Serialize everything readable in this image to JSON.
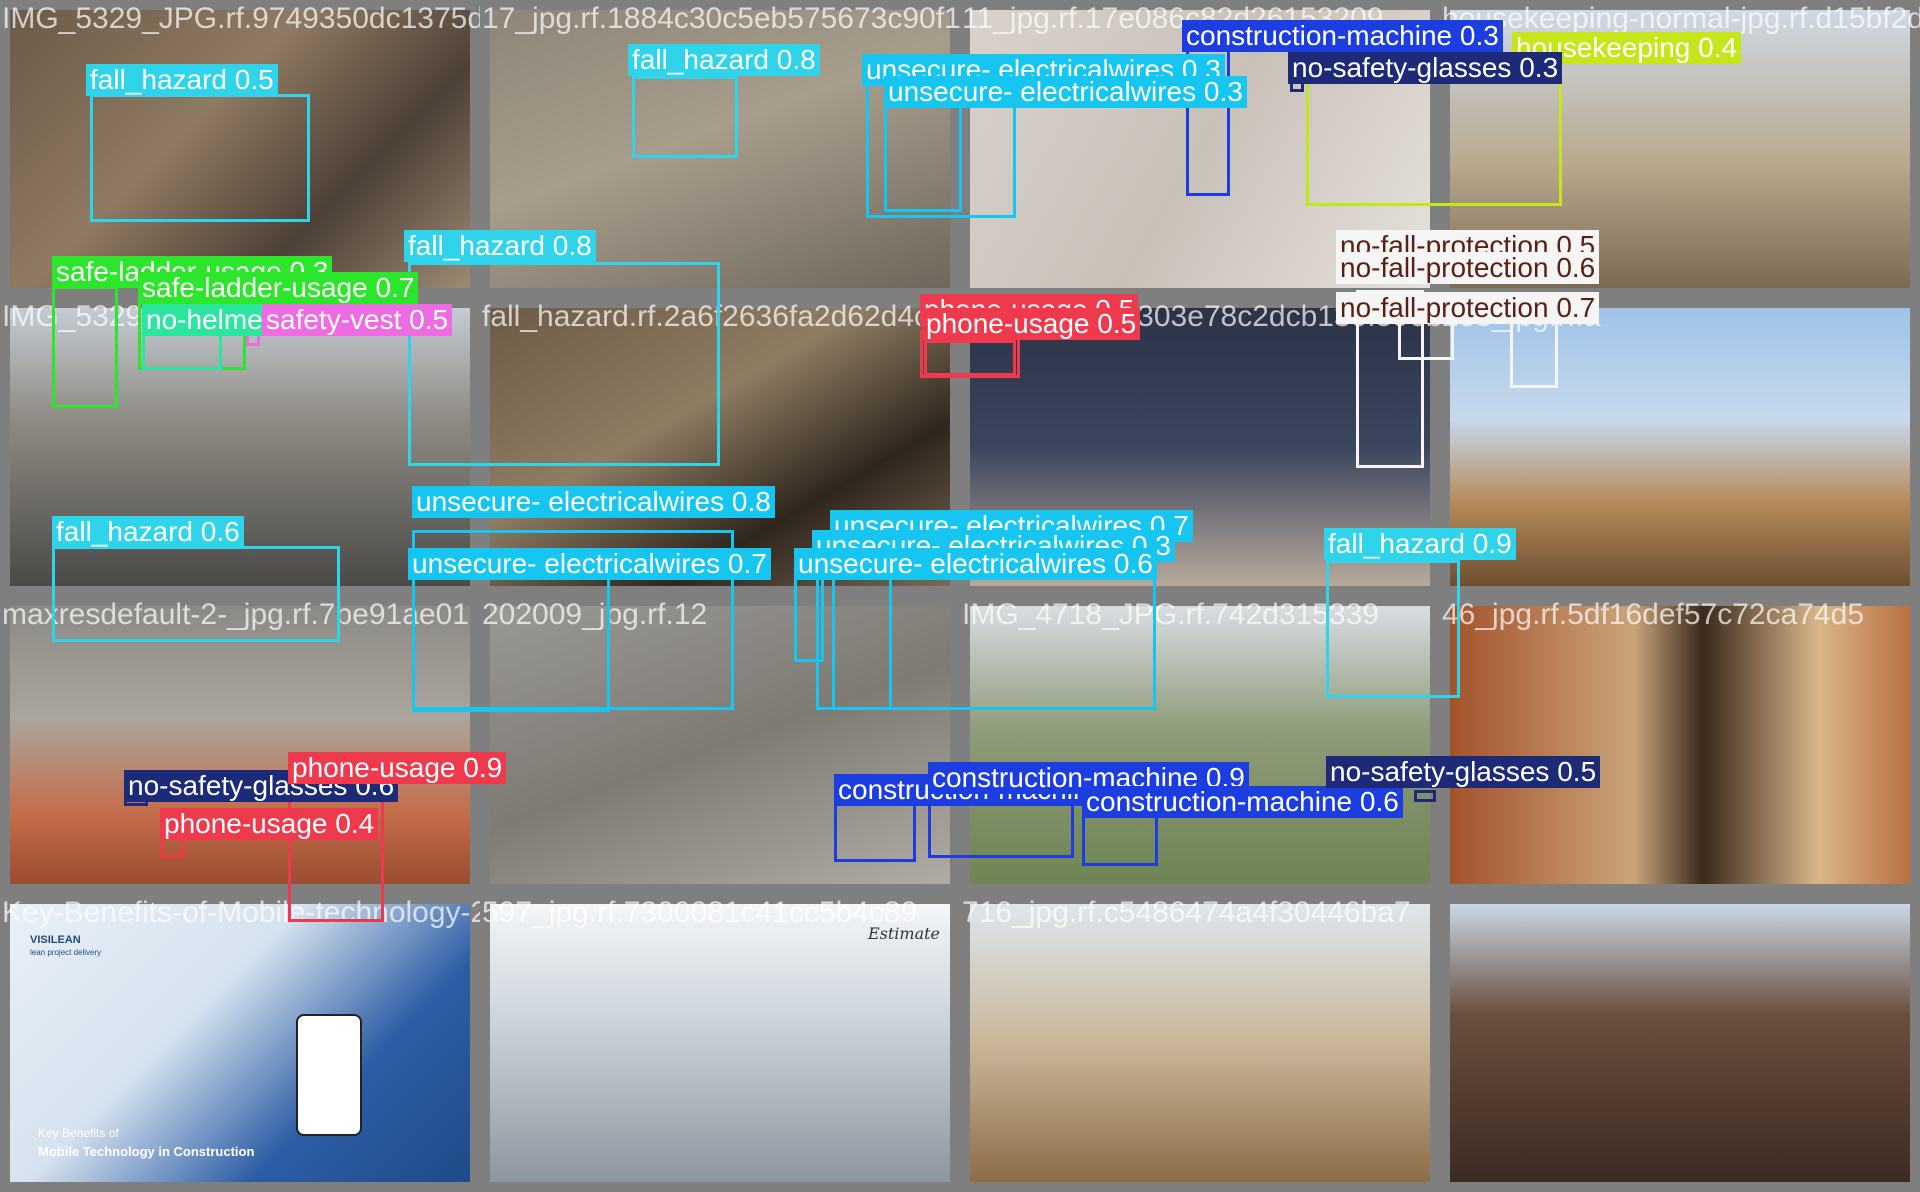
{
  "colors": {
    "fall_hazard": "#2FD3EA",
    "unsecure_electricalwires": "#16C5F0",
    "construction_machine": "#1C3EE0",
    "no_safety_glasses": "#1D2A78",
    "housekeeping": "#C6E51B",
    "safe_ladder_usage": "#2CE62C",
    "no_helmet": "#2CE6A0",
    "safety_vest": "#EE6CE2",
    "phone_usage": "#EE3A4C",
    "no_fall_protection": "#F5F5F5"
  },
  "tiles": [
    {
      "filename": "IMG_5329_JPG.rf.9749350dc1375d5f77",
      "labels": [
        {
          "text": "fall_hazard 0.5",
          "cls": "fall_hazard"
        }
      ]
    },
    {
      "filename": "17_jpg.rf.1884c30c5eb575673c90f117",
      "labels": [
        {
          "text": "fall_hazard 0.8",
          "cls": "fall_hazard"
        }
      ]
    },
    {
      "filename": "11_jpg.rf.17e086c82d26153209",
      "labels": [
        {
          "text": "unsecure- electricalwires 0.3",
          "cls": "unsecure_electricalwires"
        },
        {
          "text": "unsecure- electricalwires 0.3",
          "cls": "unsecure_electricalwires"
        }
      ]
    },
    {
      "filename": "housekeeping-normal-jpg.rf.d15bf2de",
      "labels": [
        {
          "text": "construction-machine 0.3",
          "cls": "construction_machine"
        },
        {
          "text": "housekeeping 0.4",
          "cls": "housekeeping"
        },
        {
          "text": "no-safety-glasses 0.3",
          "cls": "no_safety_glasses"
        }
      ]
    },
    {
      "filename": "IMG_5329_JPG.rf.4d99b2ce",
      "labels": [
        {
          "text": "safe-ladder-usage 0.3",
          "cls": "safe_ladder_usage"
        },
        {
          "text": "safe-ladder-usage 0.7",
          "cls": "safe_ladder_usage"
        },
        {
          "text": "no-helmet 0.4",
          "cls": "no_helmet"
        },
        {
          "text": "safety-vest 0.5",
          "cls": "safety_vest"
        }
      ]
    },
    {
      "filename": "fall_hazard.rf.2a6f2636fa2d62d4c",
      "labels": [
        {
          "text": "fall_hazard 0.8",
          "cls": "fall_hazard"
        }
      ]
    },
    {
      "filename": "20580_jpg.rf.303e78c2dcb130f596b4d",
      "labels": [
        {
          "text": "phone-usage 0.5",
          "cls": "phone_usage"
        },
        {
          "text": "phone-usage 0.5",
          "cls": "phone_usage"
        }
      ]
    },
    {
      "filename": "258_jpg.rf.a",
      "labels": [
        {
          "text": "no-fall-protection 0.5",
          "cls": "no_fall_protection"
        },
        {
          "text": "no-fall-protection 0.6",
          "cls": "no_fall_protection"
        },
        {
          "text": "no-fall-protection 0.7",
          "cls": "no_fall_protection"
        }
      ]
    },
    {
      "filename": "maxresdefault-2-_jpg.rf.7be91ae01",
      "labels": [
        {
          "text": "fall_hazard 0.6",
          "cls": "fall_hazard"
        }
      ]
    },
    {
      "filename": "202009_jpg.rf.12",
      "labels": [
        {
          "text": "unsecure- electricalwires 0.8",
          "cls": "unsecure_electricalwires"
        },
        {
          "text": "unsecure- electricalwires 0.7",
          "cls": "unsecure_electricalwires"
        }
      ]
    },
    {
      "filename": "IMG_4718_JPG.rf.742d315339",
      "labels": [
        {
          "text": "unsecure- electricalwires 0.7",
          "cls": "unsecure_electricalwires"
        },
        {
          "text": "unsecure- electricalwires 0.3",
          "cls": "unsecure_electricalwires"
        },
        {
          "text": "unsecure- electricalwires 0.6",
          "cls": "unsecure_electricalwires"
        }
      ]
    },
    {
      "filename": "46_jpg.rf.5df16def57c72ca74d5",
      "labels": [
        {
          "text": "fall_hazard 0.9",
          "cls": "fall_hazard"
        }
      ]
    },
    {
      "filename": "Key-Benefits-of-Mobile-technology-2-30-jpg.rf.5a30c564cfafaf74",
      "labels": [
        {
          "text": "no-safety-glasses 0.6",
          "cls": "no_safety_glasses"
        },
        {
          "text": "phone-usage 0.9",
          "cls": "phone_usage"
        },
        {
          "text": "phone-usage 0.4",
          "cls": "phone_usage"
        }
      ]
    },
    {
      "filename": "597_jpg.rf.7300081c41cc5b4c89",
      "labels": []
    },
    {
      "filename": "716_jpg.rf.c5486474a4f30446ba7",
      "labels": [
        {
          "text": "construction-machine 0.8",
          "cls": "construction_machine"
        },
        {
          "text": "construction-machine 0.9",
          "cls": "construction_machine"
        },
        {
          "text": "construction-machine 0.6",
          "cls": "construction_machine"
        }
      ]
    },
    {
      "filename": "",
      "labels": [
        {
          "text": "no-safety-glasses 0.5",
          "cls": "no_safety_glasses"
        }
      ]
    }
  ],
  "slide_text": {
    "brand": "VISILEAN",
    "tagline": "lean project delivery",
    "line1": "Key Benefits of",
    "line2": "Mobile Technology in Construction"
  },
  "watermark": "Estimate"
}
